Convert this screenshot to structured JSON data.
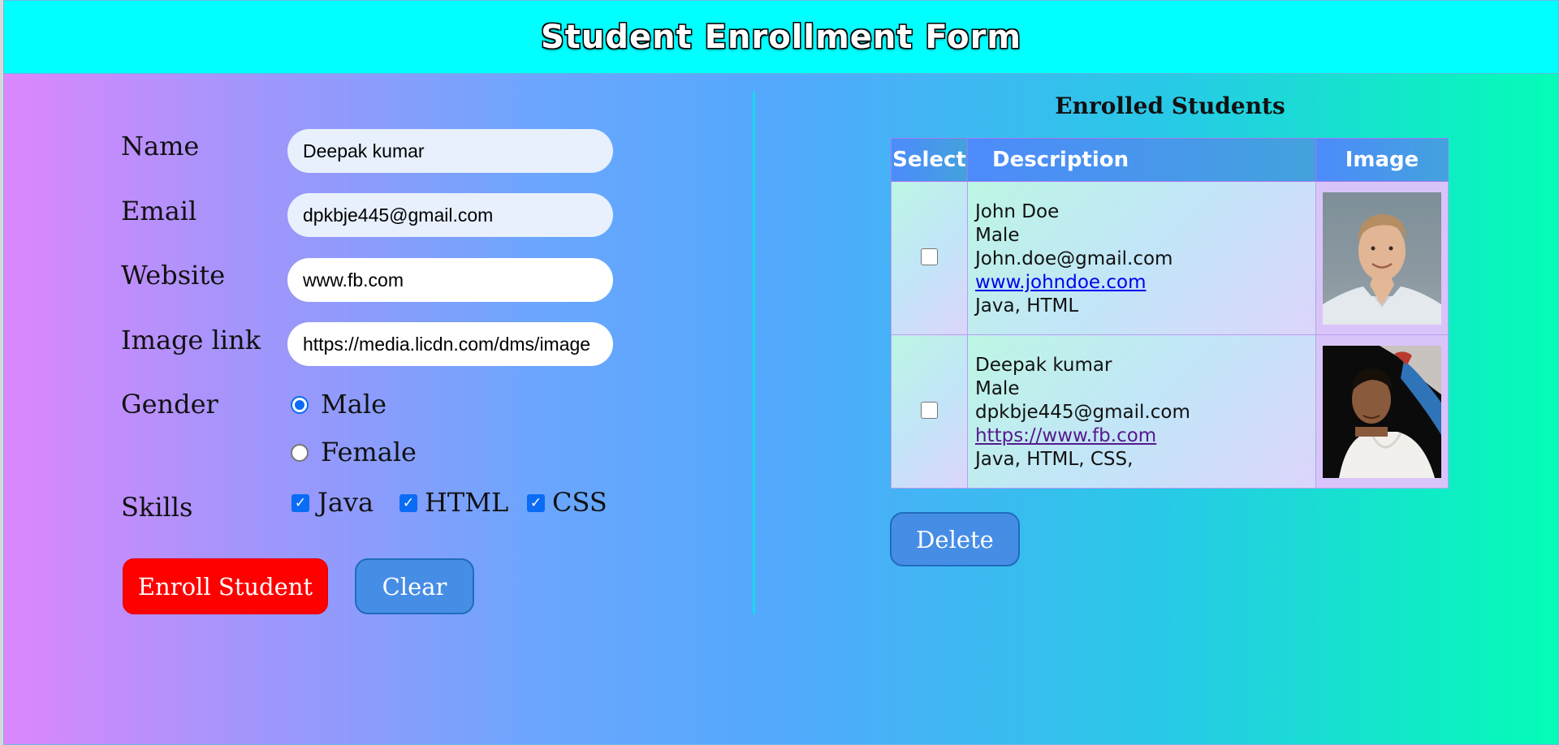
{
  "header": {
    "title": "Student Enrollment Form"
  },
  "form": {
    "name": {
      "label": "Name",
      "value": "Deepak kumar"
    },
    "email": {
      "label": "Email",
      "value": "dpkbje445@gmail.com"
    },
    "website": {
      "label": "Website",
      "value": "www.fb.com"
    },
    "image_link": {
      "label": "Image link",
      "value": "https://media.licdn.com/dms/image"
    },
    "gender": {
      "label": "Gender",
      "options": [
        "Male",
        "Female"
      ],
      "selected": "Male"
    },
    "skills": {
      "label": "Skills",
      "options": [
        "Java",
        "HTML",
        "CSS"
      ],
      "checked": [
        "Java",
        "HTML",
        "CSS"
      ]
    },
    "enroll_label": "Enroll Student",
    "clear_label": "Clear"
  },
  "enrolled": {
    "title": "Enrolled Students",
    "columns": [
      "Select",
      "Description",
      "Image"
    ],
    "rows": [
      {
        "name": "John Doe",
        "gender": "Male",
        "email": "John.doe@gmail.com",
        "website": "www.johndoe.com",
        "skills": "Java, HTML"
      },
      {
        "name": "Deepak kumar",
        "gender": "Male",
        "email": "dpkbje445@gmail.com",
        "website": "https://www.fb.com",
        "skills": "Java, HTML, CSS,"
      }
    ],
    "delete_label": "Delete"
  }
}
